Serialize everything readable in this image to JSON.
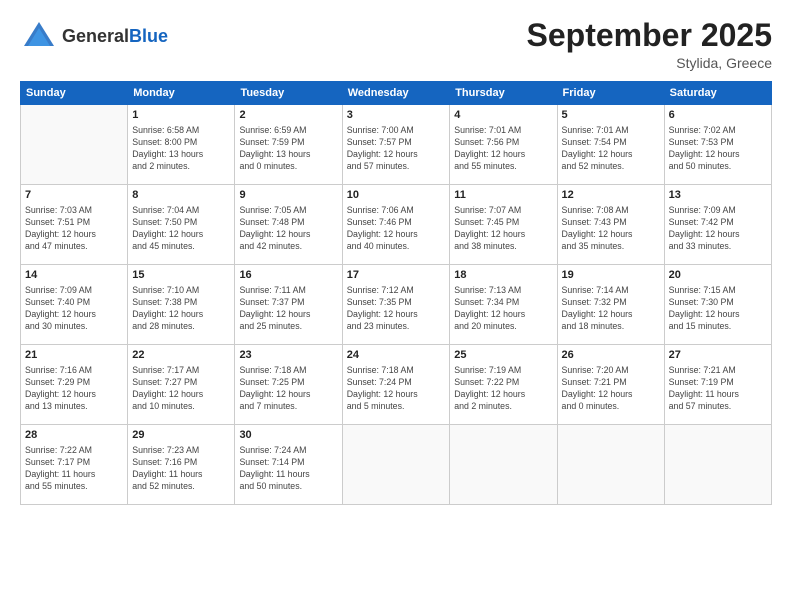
{
  "header": {
    "logo_general": "General",
    "logo_blue": "Blue",
    "month": "September 2025",
    "location": "Stylida, Greece"
  },
  "weekdays": [
    "Sunday",
    "Monday",
    "Tuesday",
    "Wednesday",
    "Thursday",
    "Friday",
    "Saturday"
  ],
  "weeks": [
    [
      {
        "day": "",
        "info": ""
      },
      {
        "day": "1",
        "info": "Sunrise: 6:58 AM\nSunset: 8:00 PM\nDaylight: 13 hours\nand 2 minutes."
      },
      {
        "day": "2",
        "info": "Sunrise: 6:59 AM\nSunset: 7:59 PM\nDaylight: 13 hours\nand 0 minutes."
      },
      {
        "day": "3",
        "info": "Sunrise: 7:00 AM\nSunset: 7:57 PM\nDaylight: 12 hours\nand 57 minutes."
      },
      {
        "day": "4",
        "info": "Sunrise: 7:01 AM\nSunset: 7:56 PM\nDaylight: 12 hours\nand 55 minutes."
      },
      {
        "day": "5",
        "info": "Sunrise: 7:01 AM\nSunset: 7:54 PM\nDaylight: 12 hours\nand 52 minutes."
      },
      {
        "day": "6",
        "info": "Sunrise: 7:02 AM\nSunset: 7:53 PM\nDaylight: 12 hours\nand 50 minutes."
      }
    ],
    [
      {
        "day": "7",
        "info": "Sunrise: 7:03 AM\nSunset: 7:51 PM\nDaylight: 12 hours\nand 47 minutes."
      },
      {
        "day": "8",
        "info": "Sunrise: 7:04 AM\nSunset: 7:50 PM\nDaylight: 12 hours\nand 45 minutes."
      },
      {
        "day": "9",
        "info": "Sunrise: 7:05 AM\nSunset: 7:48 PM\nDaylight: 12 hours\nand 42 minutes."
      },
      {
        "day": "10",
        "info": "Sunrise: 7:06 AM\nSunset: 7:46 PM\nDaylight: 12 hours\nand 40 minutes."
      },
      {
        "day": "11",
        "info": "Sunrise: 7:07 AM\nSunset: 7:45 PM\nDaylight: 12 hours\nand 38 minutes."
      },
      {
        "day": "12",
        "info": "Sunrise: 7:08 AM\nSunset: 7:43 PM\nDaylight: 12 hours\nand 35 minutes."
      },
      {
        "day": "13",
        "info": "Sunrise: 7:09 AM\nSunset: 7:42 PM\nDaylight: 12 hours\nand 33 minutes."
      }
    ],
    [
      {
        "day": "14",
        "info": "Sunrise: 7:09 AM\nSunset: 7:40 PM\nDaylight: 12 hours\nand 30 minutes."
      },
      {
        "day": "15",
        "info": "Sunrise: 7:10 AM\nSunset: 7:38 PM\nDaylight: 12 hours\nand 28 minutes."
      },
      {
        "day": "16",
        "info": "Sunrise: 7:11 AM\nSunset: 7:37 PM\nDaylight: 12 hours\nand 25 minutes."
      },
      {
        "day": "17",
        "info": "Sunrise: 7:12 AM\nSunset: 7:35 PM\nDaylight: 12 hours\nand 23 minutes."
      },
      {
        "day": "18",
        "info": "Sunrise: 7:13 AM\nSunset: 7:34 PM\nDaylight: 12 hours\nand 20 minutes."
      },
      {
        "day": "19",
        "info": "Sunrise: 7:14 AM\nSunset: 7:32 PM\nDaylight: 12 hours\nand 18 minutes."
      },
      {
        "day": "20",
        "info": "Sunrise: 7:15 AM\nSunset: 7:30 PM\nDaylight: 12 hours\nand 15 minutes."
      }
    ],
    [
      {
        "day": "21",
        "info": "Sunrise: 7:16 AM\nSunset: 7:29 PM\nDaylight: 12 hours\nand 13 minutes."
      },
      {
        "day": "22",
        "info": "Sunrise: 7:17 AM\nSunset: 7:27 PM\nDaylight: 12 hours\nand 10 minutes."
      },
      {
        "day": "23",
        "info": "Sunrise: 7:18 AM\nSunset: 7:25 PM\nDaylight: 12 hours\nand 7 minutes."
      },
      {
        "day": "24",
        "info": "Sunrise: 7:18 AM\nSunset: 7:24 PM\nDaylight: 12 hours\nand 5 minutes."
      },
      {
        "day": "25",
        "info": "Sunrise: 7:19 AM\nSunset: 7:22 PM\nDaylight: 12 hours\nand 2 minutes."
      },
      {
        "day": "26",
        "info": "Sunrise: 7:20 AM\nSunset: 7:21 PM\nDaylight: 12 hours\nand 0 minutes."
      },
      {
        "day": "27",
        "info": "Sunrise: 7:21 AM\nSunset: 7:19 PM\nDaylight: 11 hours\nand 57 minutes."
      }
    ],
    [
      {
        "day": "28",
        "info": "Sunrise: 7:22 AM\nSunset: 7:17 PM\nDaylight: 11 hours\nand 55 minutes."
      },
      {
        "day": "29",
        "info": "Sunrise: 7:23 AM\nSunset: 7:16 PM\nDaylight: 11 hours\nand 52 minutes."
      },
      {
        "day": "30",
        "info": "Sunrise: 7:24 AM\nSunset: 7:14 PM\nDaylight: 11 hours\nand 50 minutes."
      },
      {
        "day": "",
        "info": ""
      },
      {
        "day": "",
        "info": ""
      },
      {
        "day": "",
        "info": ""
      },
      {
        "day": "",
        "info": ""
      }
    ]
  ]
}
